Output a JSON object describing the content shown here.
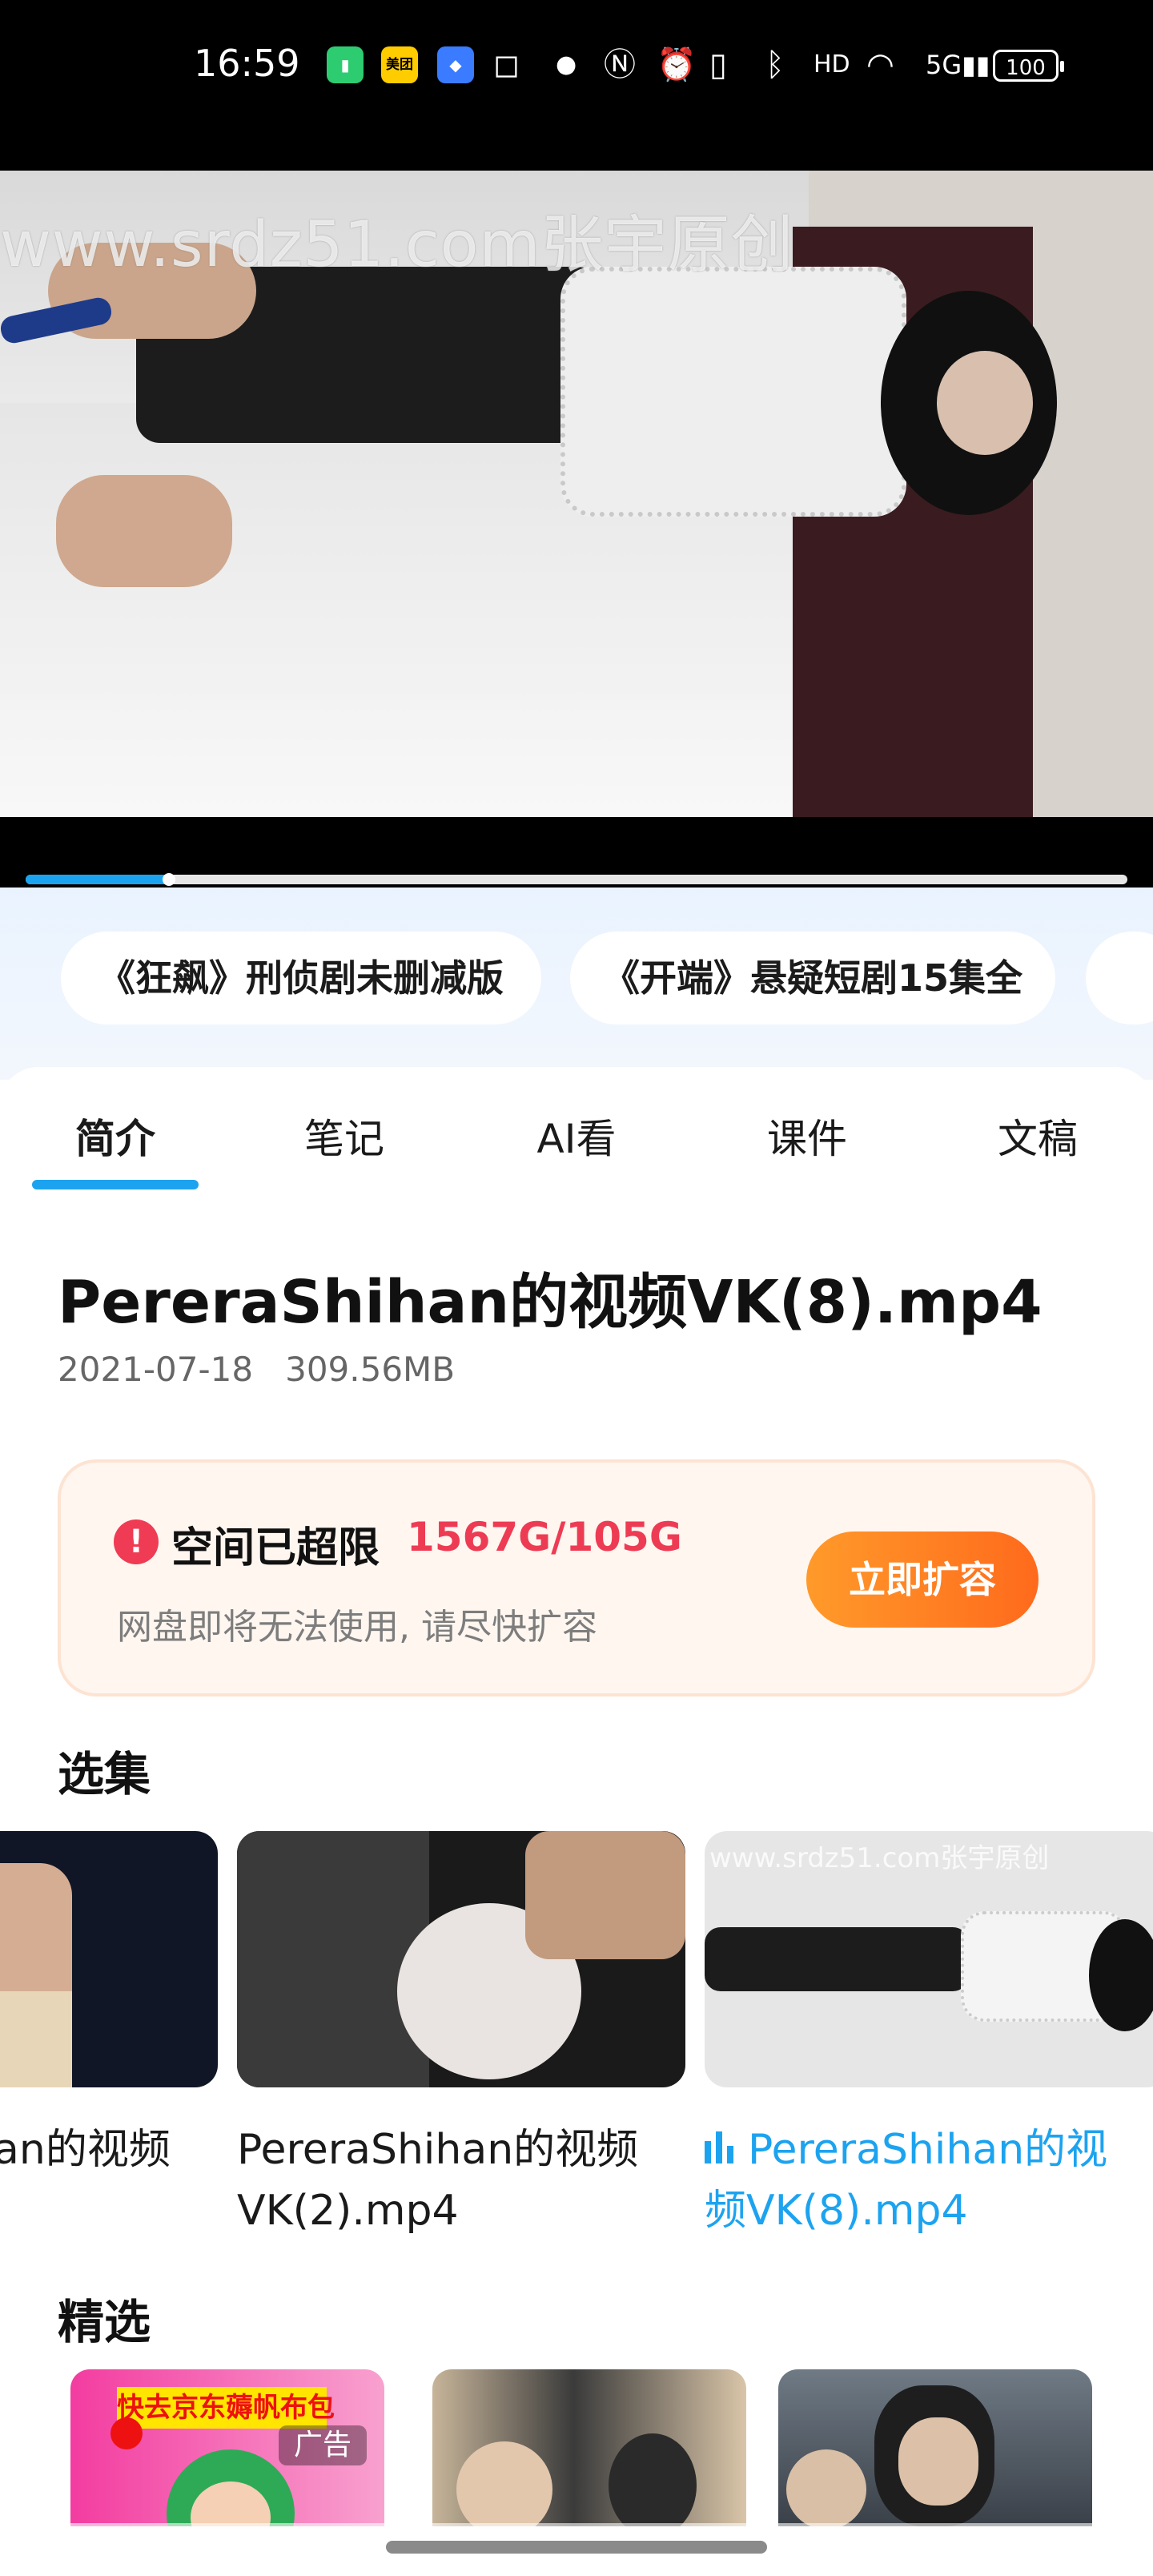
{
  "status_bar": {
    "time": "16:59",
    "apps": [
      "美团"
    ],
    "icons": [
      "battery-saver-icon",
      "meituan-app-icon",
      "app-icon",
      "instagram-icon",
      "dot-icon",
      "nfc-icon",
      "alarm-icon",
      "vibrate-icon",
      "bluetooth-icon",
      "hd-icon",
      "wifi-icon",
      "signal-5g-icon"
    ],
    "battery": "100"
  },
  "video": {
    "watermark": "www.srdz51.com张宇原创",
    "progress": 0.13
  },
  "recommend_chips": [
    "《狂飙》刑侦剧未删减版",
    "《开端》悬疑短剧15集全"
  ],
  "tabs": [
    "简介",
    "笔记",
    "AI看",
    "课件",
    "文稿"
  ],
  "active_tab": "简介",
  "file": {
    "title": "PereraShihan的视频VK(8).mp4",
    "date": "2021-07-18",
    "size": "309.56MB"
  },
  "storage_alert": {
    "icon": "!",
    "title": "空间已超限",
    "quota": "1567G/105G",
    "description": "网盘即将无法使用, 请尽快扩容",
    "button": "立即扩容"
  },
  "episodes_section": {
    "title": "选集",
    "items": [
      {
        "line1": "an的视频",
        "line2": ""
      },
      {
        "line1": "PereraShihan的视频",
        "line2": "VK(2).mp4"
      },
      {
        "line1": "PereraShihan的视",
        "line2": "频VK(8).mp4",
        "active": true
      }
    ],
    "thumb_watermark": "www.srdz51.com张宇原创"
  },
  "featured_section": {
    "title": "精选",
    "ad_banner": "快去京东薅帆布包",
    "ad_tag": "广告"
  },
  "colors": {
    "accent": "#1ca3f0",
    "alert_red": "#ee3b54",
    "button_orange": "#ff7a22"
  }
}
